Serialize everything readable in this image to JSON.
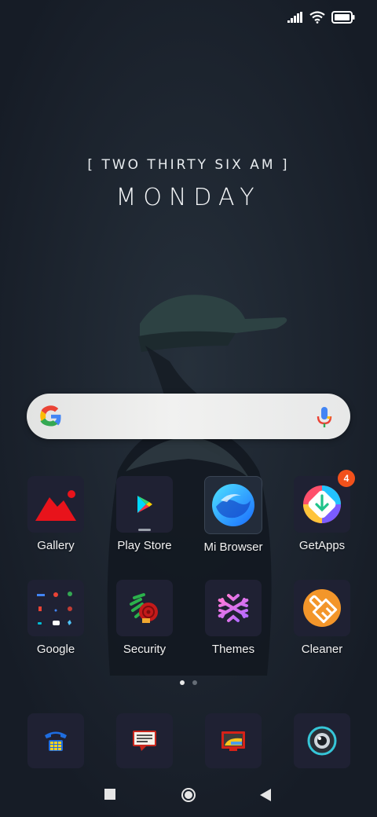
{
  "status_bar": {
    "signal_icon": "signal-bars-icon",
    "wifi_icon": "wifi-icon",
    "battery_icon": "battery-icon"
  },
  "clock_widget": {
    "time_text": "[ TWO THIRTY SIX AM ]",
    "day_text": "MONDAY"
  },
  "search_bar": {
    "logo_icon": "google-g-icon",
    "mic_icon": "microphone-icon"
  },
  "apps_row1": [
    {
      "label": "Gallery",
      "icon": "gallery-icon"
    },
    {
      "label": "Play Store",
      "icon": "play-store-icon"
    },
    {
      "label": "Mi Browser",
      "icon": "mi-browser-icon"
    },
    {
      "label": "GetApps",
      "icon": "getapps-icon",
      "badge": "4"
    }
  ],
  "apps_row2": [
    {
      "label": "Google",
      "icon": "google-folder-icon"
    },
    {
      "label": "Security",
      "icon": "security-icon"
    },
    {
      "label": "Themes",
      "icon": "themes-icon"
    },
    {
      "label": "Cleaner",
      "icon": "cleaner-icon"
    }
  ],
  "page_indicator": {
    "pages": 2,
    "current": 1
  },
  "dock": [
    {
      "icon": "phone-icon"
    },
    {
      "icon": "messages-icon"
    },
    {
      "icon": "screen-recorder-icon"
    },
    {
      "icon": "camera-icon"
    }
  ],
  "nav_bar": {
    "recents": "square-recents-icon",
    "home": "circle-home-icon",
    "back": "triangle-back-icon"
  },
  "colors": {
    "background": "#1a212c",
    "tile": "#1f2133",
    "badge": "#f2511b"
  }
}
